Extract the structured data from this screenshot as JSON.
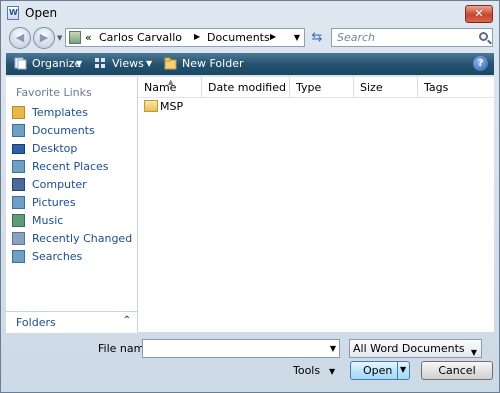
{
  "window": {
    "title": "Open",
    "close_glyph": "✕"
  },
  "navigation": {
    "back_icon": "back-arrow-icon",
    "forward_icon": "forward-arrow-icon",
    "breadcrumb_prefix": "«",
    "breadcrumb": [
      "Carlos Carvallo",
      "Documents"
    ],
    "search_placeholder": "Search"
  },
  "toolbar": {
    "organize_label": "Organize",
    "views_label": "Views",
    "new_folder_label": "New Folder",
    "help_glyph": "?"
  },
  "sidebar": {
    "header": "Favorite Links",
    "items": [
      {
        "label": "Templates",
        "icon": "templates-icon",
        "color": "#e6b84a"
      },
      {
        "label": "Documents",
        "icon": "documents-icon",
        "color": "#6f9fc6"
      },
      {
        "label": "Desktop",
        "icon": "desktop-icon",
        "color": "#2d62a8"
      },
      {
        "label": "Recent Places",
        "icon": "recent-places-icon",
        "color": "#6f9fc6"
      },
      {
        "label": "Computer",
        "icon": "computer-icon",
        "color": "#4a6a98"
      },
      {
        "label": "Pictures",
        "icon": "pictures-icon",
        "color": "#6f9fc6"
      },
      {
        "label": "Music",
        "icon": "music-icon",
        "color": "#5f9b7a"
      },
      {
        "label": "Recently Changed",
        "icon": "recently-changed-icon",
        "color": "#8aa2c2"
      },
      {
        "label": "Searches",
        "icon": "searches-icon",
        "color": "#6f9fc6"
      }
    ],
    "folders_label": "Folders",
    "folders_chevron": "⌃"
  },
  "file_list": {
    "columns": [
      "Name",
      "Date modified",
      "Type",
      "Size",
      "Tags"
    ],
    "rows": [
      {
        "name": "MSP"
      }
    ]
  },
  "footer": {
    "file_name_label": "File name:",
    "file_name_value": "",
    "file_type_value": "All Word Documents",
    "tools_label": "Tools",
    "open_label": "Open",
    "cancel_label": "Cancel"
  }
}
